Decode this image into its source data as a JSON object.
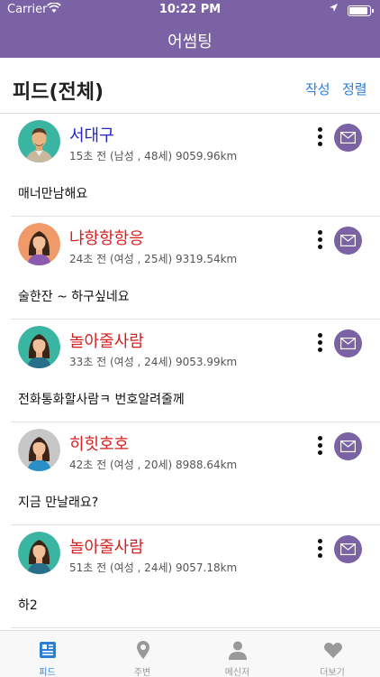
{
  "status_bar": {
    "carrier": "Carrier",
    "time": "10:22 PM",
    "battery_level": 0.9
  },
  "nav": {
    "title": "어썸팅"
  },
  "header": {
    "title": "피드(전체)",
    "write_label": "작성",
    "sort_label": "정렬"
  },
  "accent_color": "#7a62a4",
  "link_color": "#2a7fd4",
  "feed": [
    {
      "name": "서대구",
      "name_color": "#2323c8",
      "meta": "15초 전 (남성 , 48세) 9059.96km",
      "message": "매너만남해요",
      "avatar": "male-avatar"
    },
    {
      "name": "냐항항항응",
      "name_color": "#d42020",
      "meta": "24초 전 (여성 , 25세) 9319.54km",
      "message": "술한잔 ~ 하구싶네요",
      "avatar": "female-avatar-orange"
    },
    {
      "name": "놀아줄사람",
      "name_color": "#d42020",
      "meta": "33초 전 (여성 , 24세) 9053.99km",
      "message": "전화통화할사람ㅋ 번호알려줄께",
      "avatar": "female-avatar-teal"
    },
    {
      "name": "히힛호호",
      "name_color": "#d42020",
      "meta": "42초 전 (여성 , 20세) 8988.64km",
      "message": "지금 만날래요?",
      "avatar": "female-avatar-grey"
    },
    {
      "name": "놀아줄사람",
      "name_color": "#d42020",
      "meta": "51초 전 (여성 , 24세) 9057.18km",
      "message": "하2",
      "avatar": "female-avatar-teal"
    }
  ],
  "tabs": [
    {
      "label": "피드",
      "icon": "feed-icon",
      "active": true
    },
    {
      "label": "주변",
      "icon": "location-pin-icon",
      "active": false
    },
    {
      "label": "메신저",
      "icon": "person-icon",
      "active": false
    },
    {
      "label": "더보기",
      "icon": "heart-icon",
      "active": false
    }
  ]
}
